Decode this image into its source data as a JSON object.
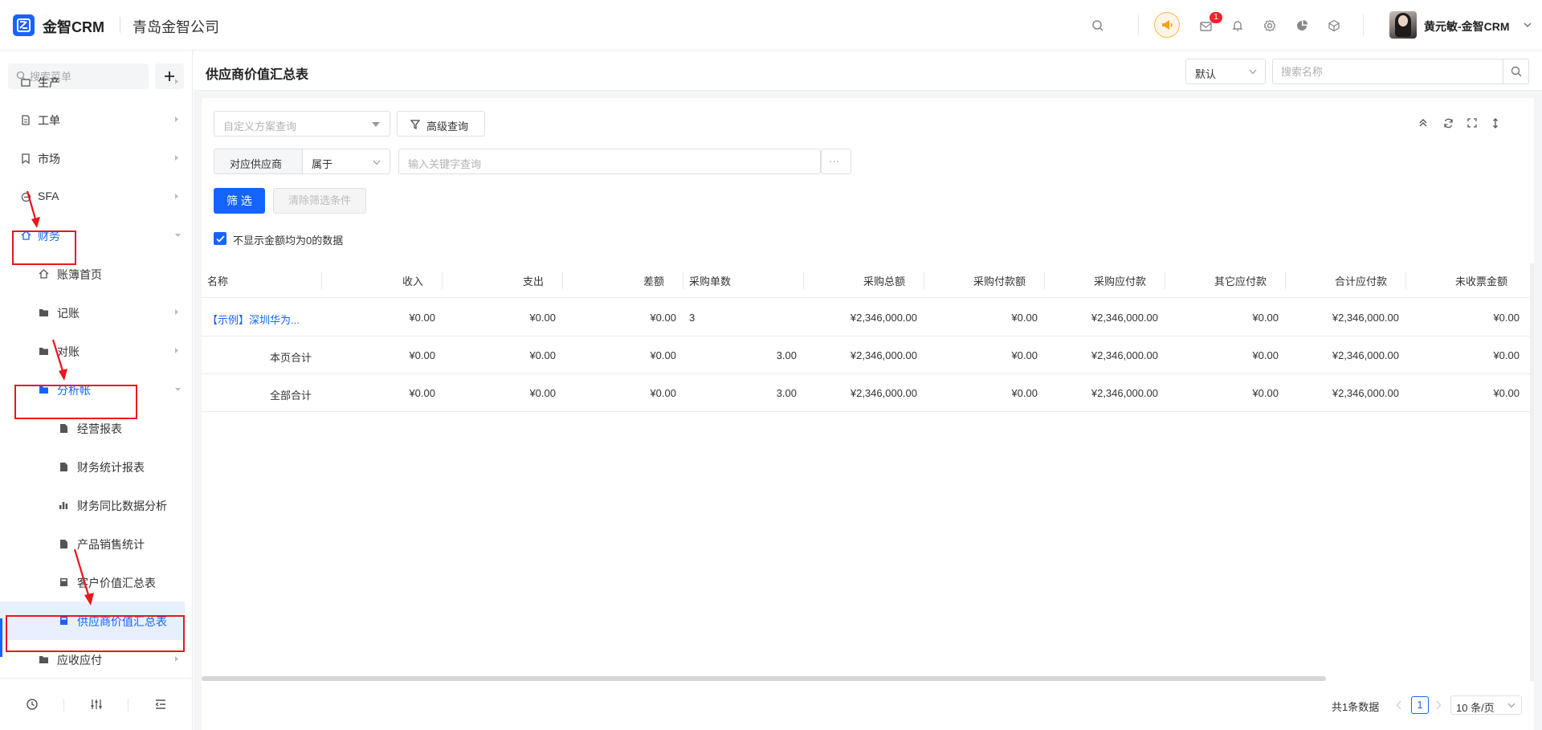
{
  "header": {
    "logo_text": "金智CRM",
    "company": "青岛金智公司",
    "notification_count": "1",
    "user_name": "黄元敏-金智CRM"
  },
  "sidebar": {
    "search_placeholder": "搜索菜单",
    "items": [
      {
        "label": "生产",
        "icon": "production-icon"
      },
      {
        "label": "工单",
        "icon": "work-order-icon"
      },
      {
        "label": "市场",
        "icon": "market-icon"
      },
      {
        "label": "SFA",
        "icon": "sfa-icon"
      },
      {
        "label": "财务",
        "icon": "home-icon"
      },
      {
        "label": "账簿首页",
        "icon": "home-icon"
      },
      {
        "label": "记账",
        "icon": "folder-icon"
      },
      {
        "label": "对账",
        "icon": "folder-icon"
      },
      {
        "label": "分析帐",
        "icon": "folder-icon"
      },
      {
        "label": "经营报表",
        "icon": "file-icon"
      },
      {
        "label": "财务统计报表",
        "icon": "file-icon"
      },
      {
        "label": "财务同比数据分析",
        "icon": "bar-chart-icon"
      },
      {
        "label": "产品销售统计",
        "icon": "file-icon"
      },
      {
        "label": "客户价值汇总表",
        "icon": "calculator-icon"
      },
      {
        "label": "供应商价值汇总表",
        "icon": "calculator-icon"
      },
      {
        "label": "应收应付",
        "icon": "folder-icon"
      }
    ]
  },
  "page": {
    "title": "供应商价值汇总表",
    "view_select": "默认",
    "name_search_placeholder": "搜索名称"
  },
  "filters": {
    "custom_query_placeholder": "自定义方案查询",
    "advanced_query": "高级查询",
    "field_label": "对应供应商",
    "operator": "属于",
    "keyword_placeholder": "输入关键字查询",
    "more": "···",
    "filter_button": "筛 选",
    "clear_button": "清除筛选条件",
    "hide_zero_label": "不显示金额均为0的数据"
  },
  "table": {
    "columns": [
      "名称",
      "收入",
      "支出",
      "差额",
      "采购单数",
      "采购总额",
      "采购付款额",
      "采购应付款",
      "其它应付款",
      "合计应付款",
      "未收票金额"
    ],
    "rows": [
      [
        "【示例】深圳华为...",
        "¥0.00",
        "¥0.00",
        "¥0.00",
        "3",
        "¥2,346,000.00",
        "¥0.00",
        "¥2,346,000.00",
        "¥0.00",
        "¥2,346,000.00",
        "¥0.00"
      ],
      [
        "本页合计",
        "¥0.00",
        "¥0.00",
        "¥0.00",
        "3.00",
        "¥2,346,000.00",
        "¥0.00",
        "¥2,346,000.00",
        "¥0.00",
        "¥2,346,000.00",
        "¥0.00"
      ],
      [
        "全部合计",
        "¥0.00",
        "¥0.00",
        "¥0.00",
        "3.00",
        "¥2,346,000.00",
        "¥0.00",
        "¥2,346,000.00",
        "¥0.00",
        "¥2,346,000.00",
        "¥0.00"
      ]
    ]
  },
  "pagination": {
    "total": "共1条数据",
    "current": "1",
    "page_size": "10 条/页"
  },
  "colors": {
    "primary": "#1664ff",
    "annotation": "#e8161e"
  }
}
